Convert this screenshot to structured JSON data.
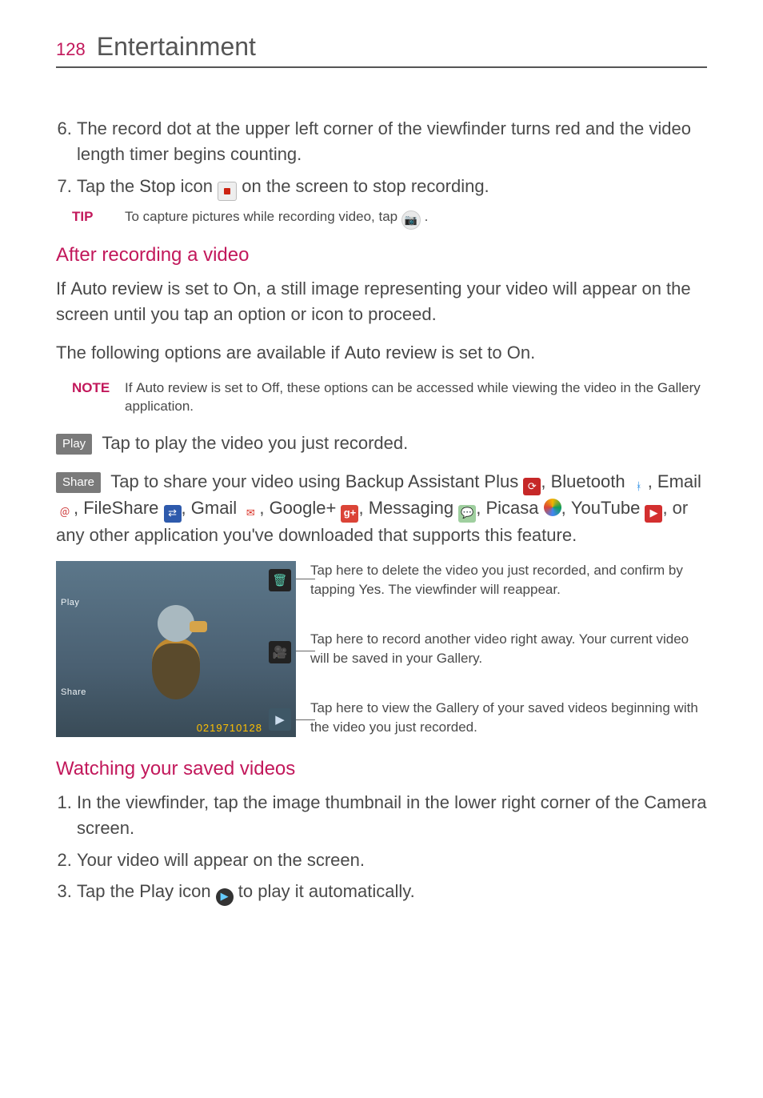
{
  "header": {
    "page_number": "128",
    "section": "Entertainment"
  },
  "steps_a": {
    "start": 6,
    "items": [
      "The record dot at the upper left corner of the viewfinder turns red and the video length timer begins counting.",
      [
        "Tap the ",
        "Stop",
        " icon ",
        "stop-icon",
        " on the screen to stop recording."
      ]
    ]
  },
  "tip": {
    "label": "TIP",
    "text_before": "To capture pictures while recording video, tap ",
    "text_after": "."
  },
  "after_recording": {
    "heading": "After recording a video",
    "para1_a": "If ",
    "para1_b": "Auto review",
    "para1_c": " is set to On, a still image representing your video will appear on the screen until you tap an option or icon to proceed.",
    "para2_a": "The following options are available if ",
    "para2_b": "Auto review",
    "para2_c": " is set to On."
  },
  "note": {
    "label": "NOTE",
    "a": "If ",
    "b": "Auto review",
    "c": " is set to Off, these options can be accessed while viewing the video in the ",
    "d": "Gallery",
    "e": " application."
  },
  "play_line": {
    "btn": "Play",
    "text": "Tap to play the video you just recorded."
  },
  "share_line": {
    "btn": "Share",
    "lead": "Tap to share your video using ",
    "apps": {
      "backup": "Backup Assistant Plus",
      "bluetooth": "Bluetooth",
      "email": "Email",
      "fileshare": "FileShare",
      "gmail": "Gmail",
      "googleplus": "Google+",
      "messaging": "Messaging",
      "picasa": "Picasa",
      "youtube": "YouTube"
    },
    "tail": ", or any other application you've downloaded that supports this feature."
  },
  "screenshot": {
    "play_label": "Play",
    "share_label": "Share",
    "timestamp": "0219710128"
  },
  "callouts": {
    "delete_a": "Tap here to delete the video you just recorded, and confirm by tapping ",
    "delete_b": "Yes",
    "delete_c": ". The viewfinder will reappear.",
    "record": "Tap here to record another video right away. Your current video will be saved in your Gallery.",
    "gallery": "Tap here to view the Gallery of your saved videos beginning with the video you just recorded."
  },
  "watching": {
    "heading": "Watching your saved videos",
    "steps": [
      "In the viewfinder, tap the image thumbnail in the lower right corner of the Camera screen.",
      "Your video will appear on the screen.",
      [
        "Tap the ",
        "Play",
        " icon ",
        "play-circle-icon",
        " to play it automatically."
      ]
    ]
  }
}
